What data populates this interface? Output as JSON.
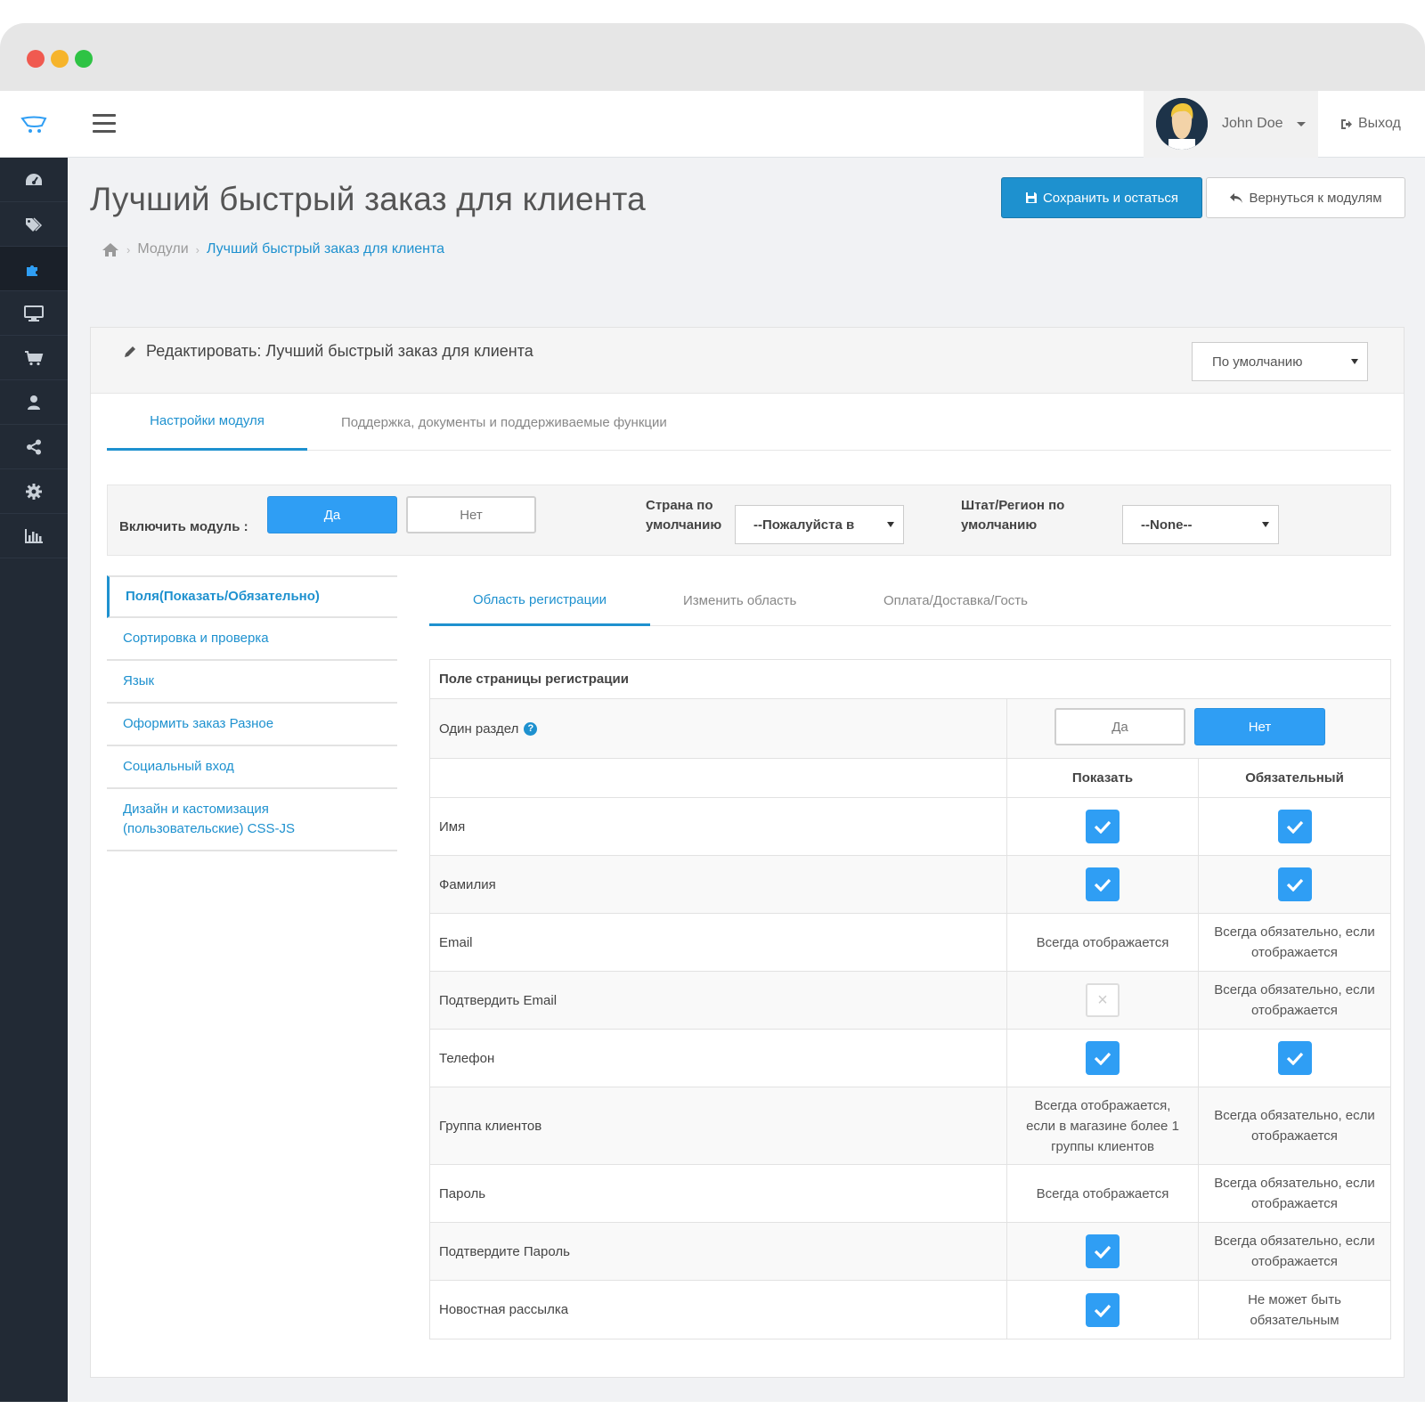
{
  "window": {
    "user_name": "John Doe",
    "logout_label": "Выход"
  },
  "sidebar": {
    "icons": [
      "dashboard-icon",
      "tag-icon",
      "puzzle-icon",
      "monitor-icon",
      "cart-icon",
      "user-icon",
      "share-icon",
      "gear-icon",
      "bar-chart-icon"
    ],
    "active_index": 2
  },
  "header": {
    "title": "Лучший быстрый заказ для клиента",
    "save_label": "Сохранить и остаться",
    "back_label": "Вернуться к модулям",
    "breadcrumb": [
      "Модули",
      "Лучший быстрый заказ для клиента"
    ]
  },
  "panel": {
    "title": "Редактировать: Лучший быстрый заказ для клиента",
    "store_select": "По умолчанию",
    "tabs": [
      "Настройки модуля",
      "Поддержка, документы и поддерживаемые функции"
    ]
  },
  "settings": {
    "enable_label": "Включить модуль :",
    "yes_label": "Да",
    "no_label": "Нет",
    "country_label_1": "Страна по",
    "country_label_2": "умолчанию",
    "country_value": "--Пожалуйста в",
    "region_label_1": "Штат/Регион по",
    "region_label_2": "умолчанию",
    "region_value": "--None--"
  },
  "vnav": [
    "Поля(Показать/Обязательно)",
    "Сортировка и проверка",
    "Язык",
    "Оформить заказ Разное",
    "Социальный вход",
    "Дизайн и кастомизация (пользовательские) CSS-JS"
  ],
  "subtabs": [
    "Область регистрации",
    "Изменить область",
    "Оплата/Доставка/Гость"
  ],
  "table": {
    "heading": "Поле страницы регистрации",
    "one_section_label": "Один раздел",
    "one_section_yes": "Да",
    "one_section_no": "Нет",
    "col_show": "Показать",
    "col_required": "Обязательный",
    "rows": [
      {
        "name": "Имя",
        "show": "checked",
        "required": "checked"
      },
      {
        "name": "Фамилия",
        "show": "checked",
        "required": "checked"
      },
      {
        "name": "Email",
        "show": "Всегда отображается",
        "required": "Всегда обязательно, если отображается"
      },
      {
        "name": "Подтвердить Email",
        "show": "unchecked",
        "required": "Всегда обязательно, если отображается"
      },
      {
        "name": "Телефон",
        "show": "checked",
        "required": "checked"
      },
      {
        "name": "Группа клиентов",
        "show": "Всегда отображается, если в магазине более 1 группы клиентов",
        "required": "Всегда обязательно, если отображается"
      },
      {
        "name": "Пароль",
        "show": "Всегда отображается",
        "required": "Всегда обязательно, если отображается"
      },
      {
        "name": "Подтвердите Пароль",
        "show": "checked",
        "required": "Всегда обязательно, если отображается"
      },
      {
        "name": "Новостная рассылка",
        "show": "checked",
        "required": "Не может быть обязательным"
      }
    ]
  },
  "colors": {
    "accent": "#1e91cf",
    "toggle_on": "#2f9ef4",
    "sidebar_bg": "#222a35"
  }
}
